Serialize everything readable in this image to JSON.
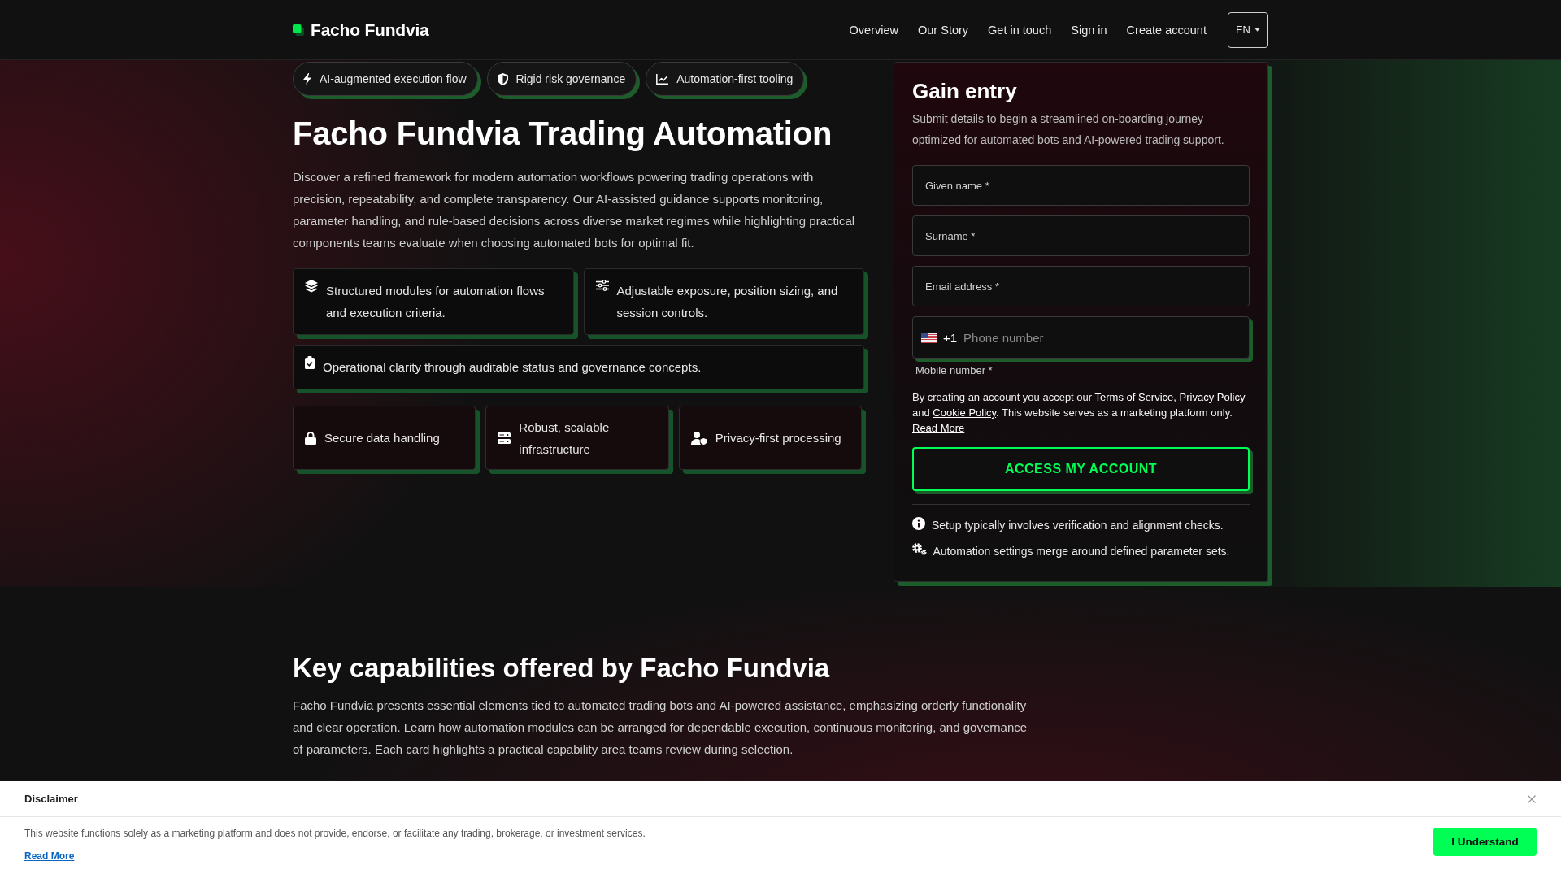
{
  "header": {
    "brand": "Facho Fundvia",
    "nav": [
      "Overview",
      "Our Story",
      "Get in touch",
      "Sign in",
      "Create account"
    ],
    "language": "EN"
  },
  "hero": {
    "chips": [
      "AI-augmented execution flow",
      "Rigid risk governance",
      "Automation-first tooling"
    ],
    "title": "Facho Fundvia Trading Automation",
    "description": "Discover a refined framework for modern automation workflows powering trading operations with precision, repeatability, and complete transparency. Our AI-assisted guidance supports monitoring, parameter handling, and rule-based decisions across diverse market regimes while highlighting practical components teams evaluate when choosing automated bots for optimal fit.",
    "features": [
      "Structured modules for automation flows and execution criteria.",
      "Adjustable exposure, position sizing, and session controls.",
      "Operational clarity through auditable status and governance concepts."
    ],
    "highlights": [
      "Secure data handling",
      "Robust, scalable infrastructure",
      "Privacy-first processing"
    ]
  },
  "signup": {
    "title": "Gain entry",
    "subtitle": "Submit details to begin a streamlined on-boarding journey optimized for automated bots and AI-powered trading support.",
    "fields": [
      {
        "kind": "text",
        "placeholder": "Given name *"
      },
      {
        "kind": "text",
        "placeholder": "Surname *"
      },
      {
        "kind": "text",
        "placeholder": "Email address *"
      },
      {
        "kind": "phone",
        "dial_code": "+1",
        "placeholder": "Phone number",
        "label": "Mobile number *"
      }
    ],
    "consent": [
      {
        "kind": "text",
        "text": "By creating an account you accept our "
      },
      {
        "kind": "link",
        "text": "Terms of Service"
      },
      {
        "kind": "text",
        "text": ", "
      },
      {
        "kind": "link",
        "text": "Privacy Policy"
      },
      {
        "kind": "text",
        "text": " and "
      },
      {
        "kind": "link",
        "text": "Cookie Policy"
      },
      {
        "kind": "text",
        "text": ". This website serves as a marketing platform only. "
      },
      {
        "kind": "link",
        "text": "Read More"
      }
    ],
    "submit": "ACCESS MY ACCOUNT",
    "notes": [
      "Setup typically involves verification and alignment checks.",
      "Automation settings merge around defined parameter sets."
    ]
  },
  "capabilities": {
    "title": "Key capabilities offered by Facho Fundvia",
    "description": "Facho Fundvia presents essential elements tied to automated trading bots and AI-powered assistance, emphasizing orderly functionality and clear operation. Learn how automation modules can be arranged for dependable execution, continuous monitoring, and governance of parameters. Each card highlights a practical capability area teams review during selection."
  },
  "disclaimer": {
    "title": "Disclaimer",
    "text": "This website functions solely as a marketing platform and does not provide, endorse, or facilitate any trading, brokerage, or investment services.",
    "link": "Read More",
    "button": "I Understand"
  }
}
